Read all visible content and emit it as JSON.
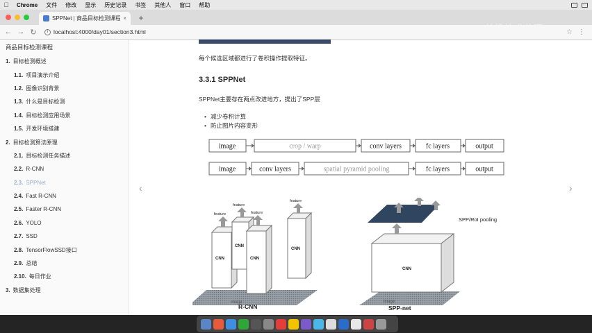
{
  "menubar": {
    "apple_icon": "apple-icon",
    "items": [
      "Chrome",
      "文件",
      "修改",
      "显示",
      "历史记录",
      "书签",
      "其他人",
      "窗口",
      "帮助"
    ]
  },
  "browser": {
    "tab_title": "SPPNet | 商品目标检测课程资",
    "url": "localhost:4000/day01/section3.html",
    "watermark": "AI前沿技术分享"
  },
  "sidebar": {
    "title": "商品目标检测课程",
    "items": [
      {
        "num": "1.",
        "label": "目标检测概述",
        "level": 1
      },
      {
        "num": "1.1.",
        "label": "项目演示介绍",
        "level": 2
      },
      {
        "num": "1.2.",
        "label": "图像识别背景",
        "level": 2
      },
      {
        "num": "1.3.",
        "label": "什么是目标检测",
        "level": 2
      },
      {
        "num": "1.4.",
        "label": "目标检测应用场景",
        "level": 2
      },
      {
        "num": "1.5.",
        "label": "开发环境搭建",
        "level": 2
      },
      {
        "num": "2.",
        "label": "目标检测算法原理",
        "level": 1
      },
      {
        "num": "2.1.",
        "label": "目标检测任务描述",
        "level": 2
      },
      {
        "num": "2.2.",
        "label": "R-CNN",
        "level": 2
      },
      {
        "num": "2.3.",
        "label": "SPPNet",
        "level": 2
      },
      {
        "num": "2.4.",
        "label": "Fast R-CNN",
        "level": 2
      },
      {
        "num": "2.5.",
        "label": "Faster R-CNN",
        "level": 2
      },
      {
        "num": "2.6.",
        "label": "YOLO",
        "level": 2
      },
      {
        "num": "2.7.",
        "label": "SSD",
        "level": 2
      },
      {
        "num": "2.8.",
        "label": "TensorFlowSSD接口",
        "level": 2
      },
      {
        "num": "2.9.",
        "label": "总结",
        "level": 2
      },
      {
        "num": "2.10.",
        "label": "每日作业",
        "level": 2
      },
      {
        "num": "3.",
        "label": "数据集处理",
        "level": 1
      }
    ]
  },
  "main": {
    "intro": "每个候选区域都进行了卷积操作提取特征。",
    "heading": "3.3.1 SPPNet",
    "desc": "SPPNet主要存在两点改进地方，提出了SPP层",
    "bullets": [
      "减少卷积计算",
      "防止图片内容变形"
    ],
    "pipeline1": [
      "image",
      "crop / warp",
      "conv layers",
      "fc layers",
      "output"
    ],
    "pipeline2": [
      "image",
      "conv layers",
      "spatial pyramid pooling",
      "fc layers",
      "output"
    ],
    "figure": {
      "rcnn_caption": "R-CNN",
      "sppnet_caption": "SPP-net",
      "cnn_label": "CNN",
      "feature_label": "feature",
      "image_label": "image",
      "spp_pool_label": "SPP/RoI pooling"
    }
  }
}
